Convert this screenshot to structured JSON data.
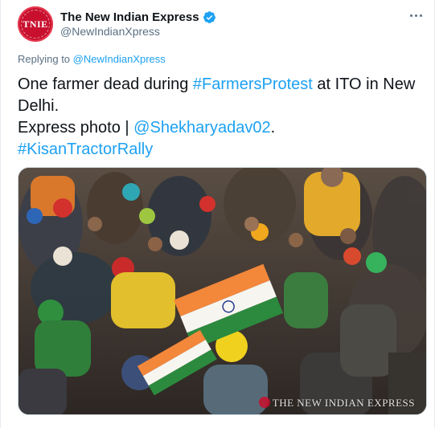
{
  "tweet": {
    "avatar_text": "TNIE",
    "display_name": "The New Indian Express",
    "handle": "@NewIndianXpress",
    "replying_prefix": "Replying to",
    "replying_to": "@NewIndianXpress",
    "text_line1_a": "One farmer dead during ",
    "hashtag1": "#FarmersProtest",
    "text_line1_b": " at ITO in New Delhi.",
    "text_line2_a": "Express photo | ",
    "mention": "@Shekharyadav02",
    "text_line2_b": ".",
    "hashtag2": "#KisanTractorRally",
    "watermark": "THE NEW INDIAN EXPRESS"
  },
  "colors": {
    "link": "#1da1f2",
    "secondary_text": "#5b7083",
    "brand_red": "#c8102e",
    "verified_blue": "#1da1f2"
  },
  "icons": {
    "verified": "verified-badge-icon",
    "more": "more-options-icon"
  }
}
